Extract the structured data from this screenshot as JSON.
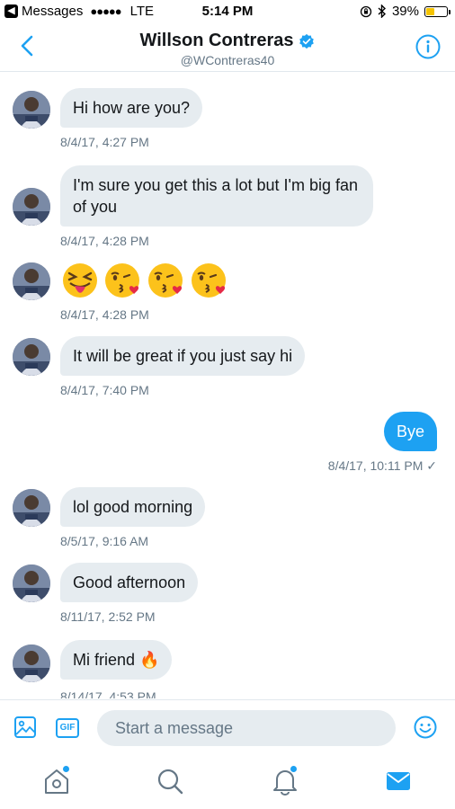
{
  "status_bar": {
    "back_app": "Messages",
    "signal": "●●●●●",
    "carrier": "LTE",
    "time": "5:14 PM",
    "battery": "39%"
  },
  "header": {
    "name": "Willson Contreras",
    "handle": "@WContreras40"
  },
  "messages": [
    {
      "dir": "in",
      "text": "Hi how are you?",
      "time": "8/4/17, 4:27 PM"
    },
    {
      "dir": "in",
      "text": "I'm sure you get this a lot but I'm big fan of you",
      "time": "8/4/17, 4:28 PM"
    },
    {
      "dir": "in",
      "emojis": [
        "squinting-tongue-emoji",
        "kiss-heart-emoji",
        "kiss-heart-emoji",
        "kiss-heart-emoji"
      ],
      "time": "8/4/17, 4:28 PM"
    },
    {
      "dir": "in",
      "text": "It will be great if you just say hi",
      "time": "8/4/17, 7:40 PM"
    },
    {
      "dir": "out",
      "text": "Bye",
      "time": "8/4/17, 10:11 PM ✓"
    },
    {
      "dir": "in",
      "text": "lol good morning",
      "time": "8/5/17, 9:16 AM"
    },
    {
      "dir": "in",
      "text": "Good afternoon",
      "time": "8/11/17, 2:52 PM"
    },
    {
      "dir": "in",
      "text": "Mi friend 🔥",
      "time": "8/14/17, 4:53 PM"
    }
  ],
  "composer": {
    "gif_label": "GIF",
    "placeholder": "Start a message"
  },
  "colors": {
    "accent": "#1da1f2",
    "bubble_in": "#e6ecf0",
    "secondary_text": "#657786"
  }
}
